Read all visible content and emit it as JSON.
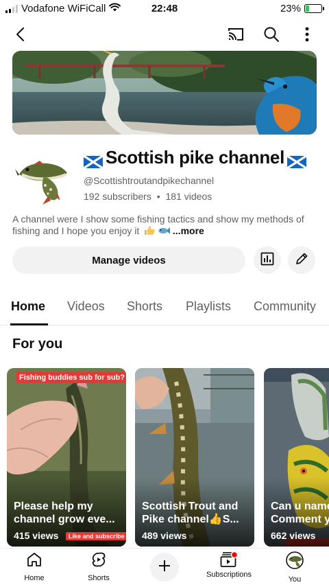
{
  "status_bar": {
    "carrier": "Vodafone WiFiCall",
    "time": "22:48",
    "battery": "23%",
    "battery_level": 0.23
  },
  "top_bar": {
    "icons": [
      "back-arrow-icon",
      "cast-icon",
      "search-icon",
      "more-vert-icon"
    ]
  },
  "channel": {
    "name": "Scottish pike channel",
    "handle": "@Scottishtroutandpikechannel",
    "subscribers": "192 subscribers",
    "separator": "•",
    "videos": "181 videos",
    "description": "A channel were I show some fishing tactics and show my methods of fishing and I hope you enjoy it",
    "description_emoji": [
      "thumbs-up-icon",
      "fish-icon"
    ],
    "more": "...more"
  },
  "actions": {
    "manage_videos": "Manage videos",
    "icons": [
      "analytics-icon",
      "edit-pencil-icon"
    ]
  },
  "tabs": [
    {
      "label": "Home",
      "active": true
    },
    {
      "label": "Videos"
    },
    {
      "label": "Shorts"
    },
    {
      "label": "Playlists"
    },
    {
      "label": "Community"
    }
  ],
  "section": {
    "title": "For you"
  },
  "cards": [
    {
      "title": "Please help my channel grow eve...",
      "views": "415 views",
      "overlay_top": "Fishing buddies sub for sub?",
      "overlay_bottom": "Like and subscribe"
    },
    {
      "title": "Scottish Trout and Pike channel👍S...",
      "views": "489 views"
    },
    {
      "title": "Can u name Comment y",
      "views": "662 views"
    }
  ],
  "bottom_nav": {
    "home": "Home",
    "shorts": "Shorts",
    "subscriptions": "Subscriptions",
    "you": "You"
  },
  "colors": {
    "accent": "#0f0f0f",
    "secondary_text": "#606060",
    "button_bg": "#f2f2f2",
    "notification_dot": "#ff0000",
    "overlay_red": "#e53935"
  }
}
